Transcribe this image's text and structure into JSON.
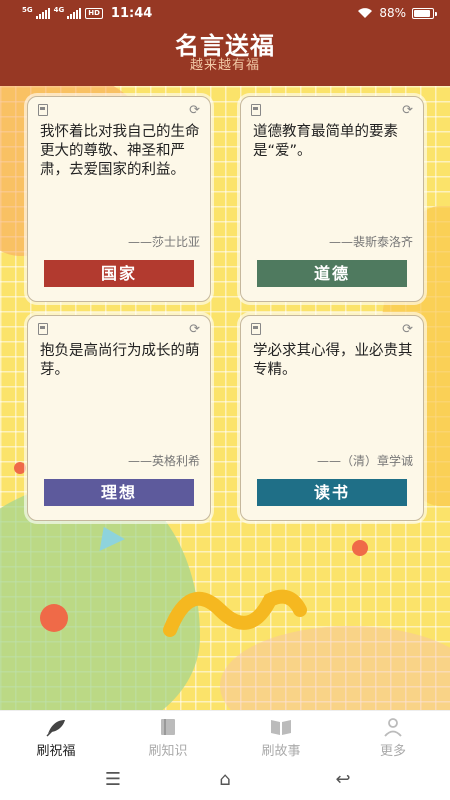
{
  "status_bar": {
    "network_left": "5G",
    "network_right": "4G",
    "hd": "HD",
    "time": "11:44",
    "wifi_icon": "wifi-icon",
    "battery_percent": "88%",
    "battery_level": 0.88
  },
  "header": {
    "title": "名言送福",
    "subtitle": "越来越有福"
  },
  "cards": [
    {
      "quote": "我怀着比对我自己的生命更大的尊敬、神圣和严肃，去爱国家的利益。",
      "author": "——莎士比亚",
      "tag": "国家",
      "tag_color": "#b23a2f"
    },
    {
      "quote": "道德教育最简单的要素是“爱”。",
      "author": "——裴斯泰洛齐",
      "tag": "道德",
      "tag_color": "#4f7a5f"
    },
    {
      "quote": "抱负是高尚行为成长的萌芽。",
      "author": "——英格利希",
      "tag": "理想",
      "tag_color": "#5d5a9c"
    },
    {
      "quote": "学必求其心得，业必贵其专精。",
      "author": "——（清）章学诚",
      "tag": "读书",
      "tag_color": "#1f6f87"
    }
  ],
  "tabs": [
    {
      "label": "刷祝福",
      "icon": "feather-icon"
    },
    {
      "label": "刷知识",
      "icon": "book-icon"
    },
    {
      "label": "刷故事",
      "icon": "open-book-icon"
    },
    {
      "label": "更多",
      "icon": "person-icon"
    }
  ],
  "system_nav": {
    "menu": "☰",
    "home": "⌂",
    "back": "↩"
  }
}
